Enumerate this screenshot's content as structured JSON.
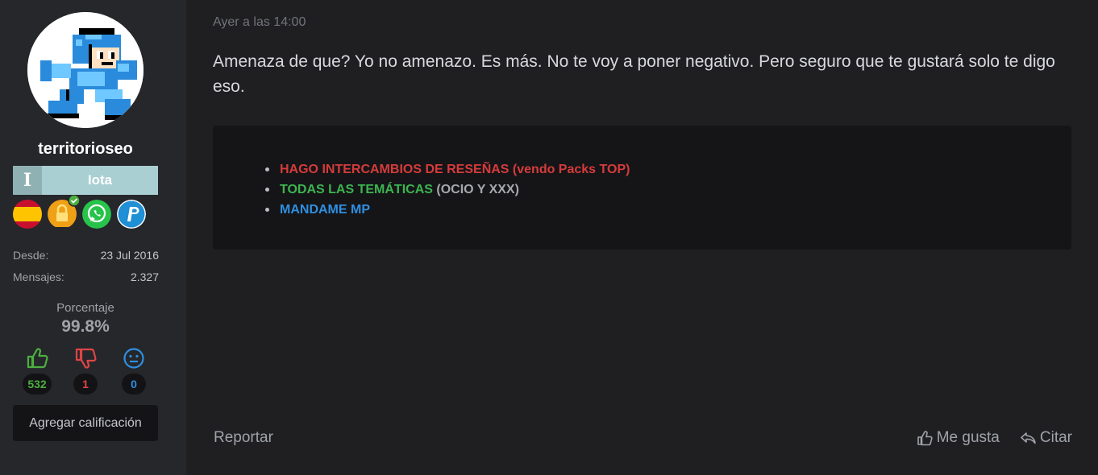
{
  "user": {
    "username": "territorioseo",
    "rank_letter": "I",
    "rank_name": "Iota",
    "badges": [
      "spain-flag-icon",
      "verified-lock-icon",
      "whatsapp-icon",
      "paypal-icon"
    ],
    "since_label": "Desde:",
    "since_value": "23 Jul 2016",
    "messages_label": "Mensajes:",
    "messages_value": "2.327",
    "percent_label": "Porcentaje",
    "percent_value": "99.8%",
    "ratings": {
      "positive": {
        "icon": "thumbs-up-icon",
        "count": "532",
        "color": "#4caf3f"
      },
      "negative": {
        "icon": "thumbs-down-icon",
        "count": "1",
        "color": "#e04545"
      },
      "neutral": {
        "icon": "neutral-face-icon",
        "count": "0",
        "color": "#2f8fe0"
      }
    },
    "rate_button": "Agregar calificación"
  },
  "post": {
    "timestamp": "Ayer a las 14:00",
    "message": "Amenaza de que? Yo no amenazo. Es más. No te voy a poner negativo. Pero seguro que te gustará solo te digo eso."
  },
  "signature": {
    "line1": "HAGO INTERCAMBIOS DE RESEÑAS (vendo Packs TOP)",
    "line2_main": "TODAS LAS TEMÁTICAS",
    "line2_extra": " (OCIO Y XXX)",
    "line3": "MANDAME MP",
    "colors": {
      "red": "#d63b3b",
      "green": "#3cb550",
      "grey": "#a6a8ad",
      "blue": "#2f8fe0"
    }
  },
  "footer": {
    "report": "Reportar",
    "like": "Me gusta",
    "quote": "Citar"
  }
}
